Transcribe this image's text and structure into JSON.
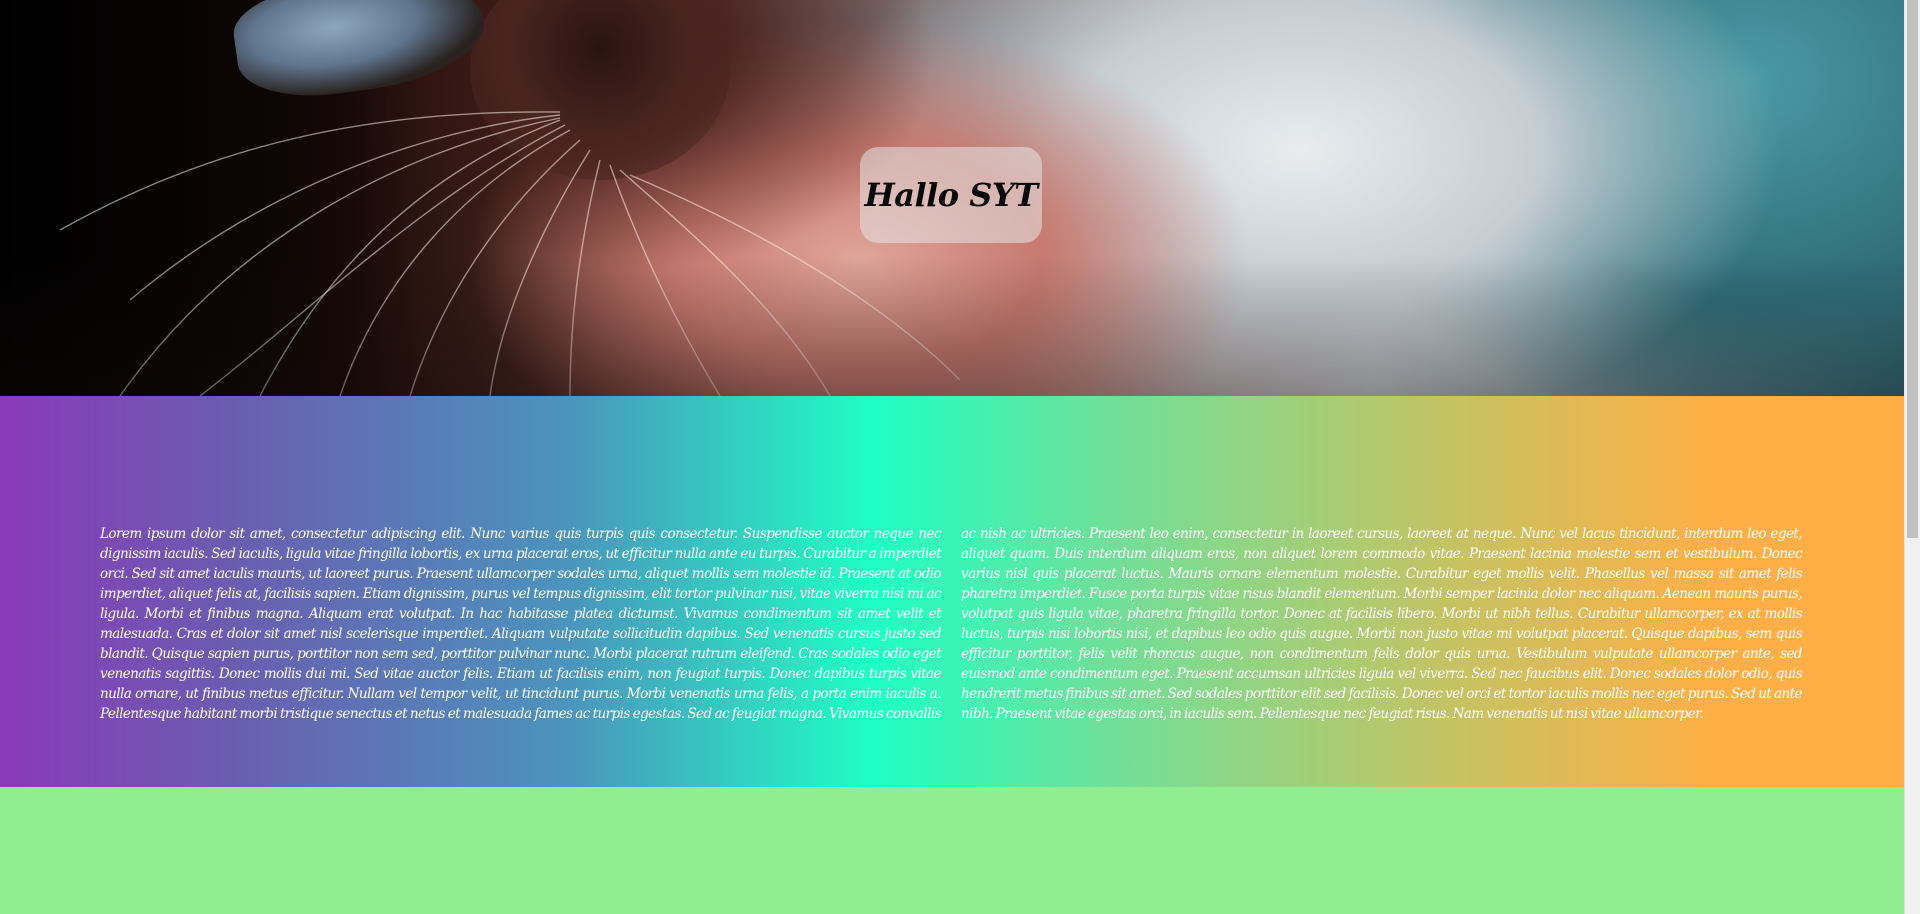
{
  "hero": {
    "title": "Hallo SYT"
  },
  "content": {
    "text": "Lorem ipsum dolor sit amet, consectetur adipiscing elit. Nunc varius quis turpis quis consectetur. Suspendisse auctor neque nec dignissim iaculis. Sed iaculis, ligula vitae fringilla lobortis, ex urna placerat eros, ut efficitur nulla ante eu turpis. Curabitur a imperdiet orci. Sed sit amet iaculis mauris, ut laoreet purus. Praesent ullamcorper sodales urna, aliquet mollis sem molestie id. Praesent at odio imperdiet, aliquet felis at, facilisis sapien. Etiam dignissim, purus vel tempus dignissim, elit tortor pulvinar nisi, vitae viverra nisi mi ac ligula. Morbi et finibus magna. Aliquam erat volutpat. In hac habitasse platea dictumst. Vivamus condimentum sit amet velit et malesuada. Cras et dolor sit amet nisl scelerisque imperdiet. Aliquam vulputate sollicitudin dapibus. Sed venenatis cursus justo sed blandit. Quisque sapien purus, porttitor non sem sed, porttitor pulvinar nunc. Morbi placerat rutrum eleifend. Cras sodales odio eget venenatis sagittis. Donec mollis dui mi. Sed vitae auctor felis. Etiam ut facilisis enim, non feugiat turpis. Donec dapibus turpis vitae nulla ornare, ut finibus metus efficitur. Nullam vel tempor velit, ut tincidunt purus. Morbi venenatis urna felis, a porta enim iaculis a. Pellentesque habitant morbi tristique senectus et netus et malesuada fames ac turpis egestas. Sed ac feugiat magna. Vivamus convallis ac nish ac ultricies. Praesent leo enim, consectetur in laoreet cursus, laoreet at neque. Nunc vel lacus tincidunt, interdum leo eget, aliquet quam. Duis interdum aliquam eros, non aliquet lorem commodo vitae. Praesent lacinia molestie sem et vestibulum. Donec varius nisl quis placerat luctus. Mauris ornare elementum molestie. Curabitur eget mollis velit. Phasellus vel massa sit amet felis pharetra imperdiet. Fusce porta turpis vitae risus blandit elementum. Morbi semper lacinia dolor nec aliquam. Aenean mauris purus, volutpat quis ligula vitae, pharetra fringilla tortor. Donec at facilisis libero. Morbi ut nibh tellus. Curabitur ullamcorper, ex at mollis luctus, turpis nisi lobortis nisi, et dapibus leo odio quis augue. Morbi non justo vitae mi volutpat placerat. Quisque dapibus, sem quis efficitur porttitor, felis velit rhoncus augue, non condimentum felis dolor quis urna. Vestibulum vulputate ullamcorper ante, sed euismod ante condimentum eget. Praesent accumsan ultricies ligula vel viverra. Sed nec faucibus elit. Donec sodales dolor odio, quis hendrerit metus finibus sit amet. Sed sodales porttitor elit sed facilisis. Donec vel orci et tortor iaculis mollis nec eget purus. Sed ut ante nibh. Praesent vitae egestas orci, in iaculis sem. Pellentesque nec feugiat risus. Nam venenatis ut nisi vitae ullamcorper."
  },
  "colors": {
    "gradient_start": "#8a3ab9",
    "gradient_mid": "#1fffc4",
    "gradient_end": "#ffaf45",
    "footer_green": "#90ee90"
  },
  "icons": {
    "scrollbar": "vertical-scrollbar"
  }
}
